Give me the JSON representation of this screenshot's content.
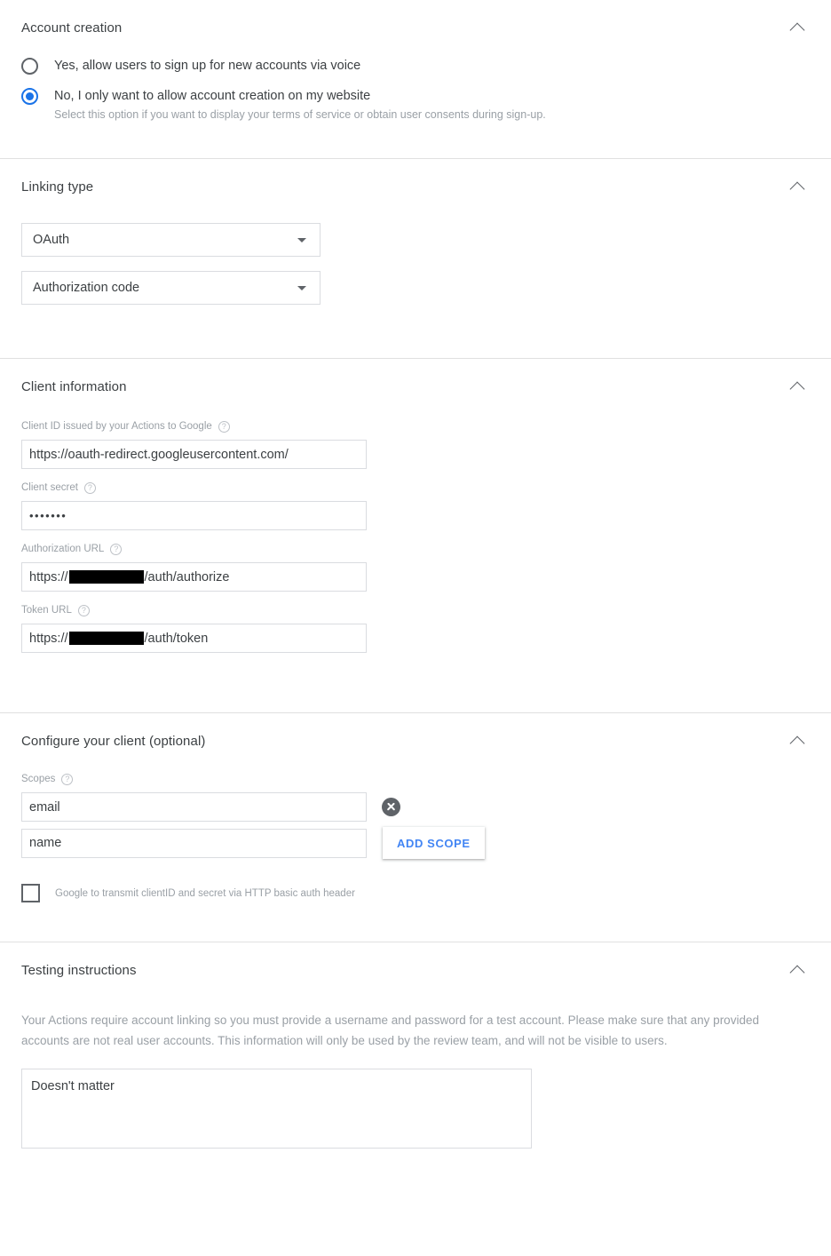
{
  "sections": [
    {
      "id": "account-creation",
      "title": "Account creation",
      "collapse_icon": "chevron-up-icon",
      "options": [
        {
          "label": "Yes, allow users to sign up for new accounts via voice",
          "selected": false,
          "sublabel": ""
        },
        {
          "label": "No, I only want to allow account creation on my website",
          "selected": true,
          "sublabel": "Select this option if you want to display your terms of service or obtain user consents during sign-up."
        }
      ]
    },
    {
      "id": "linking-type",
      "title": "Linking type",
      "collapse_icon": "chevron-up-icon",
      "selects": [
        {
          "name": "linking-type-select",
          "value": "OAuth"
        },
        {
          "name": "grant-type-select",
          "value": "Authorization code"
        }
      ]
    },
    {
      "id": "client-information",
      "title": "Client information",
      "collapse_icon": "chevron-up-icon",
      "fields": [
        {
          "name": "client-id-field",
          "label": "Client ID issued by your Actions to Google",
          "help": "help-icon",
          "value": "https://oauth-redirect.googleusercontent.com/",
          "type": "text"
        },
        {
          "name": "client-secret-field",
          "label": "Client secret",
          "help": "help-icon",
          "value": "•••••••",
          "type": "password"
        },
        {
          "name": "authorization-url-field",
          "label": "Authorization URL",
          "help": "help-icon",
          "prefix": "https://",
          "redacted": true,
          "suffix": "/auth/authorize",
          "type": "redacted"
        },
        {
          "name": "token-url-field",
          "label": "Token URL",
          "help": "help-icon",
          "prefix": "https://",
          "redacted": true,
          "suffix": "/auth/token",
          "type": "redacted"
        }
      ]
    },
    {
      "id": "configure-client",
      "title": "Configure your client (optional)",
      "collapse_icon": "chevron-up-icon",
      "scopes_label": "Scopes",
      "scopes_help": "help-icon",
      "scopes": [
        {
          "value": "email",
          "has_remove": true
        },
        {
          "value": "name",
          "has_remove": false
        }
      ],
      "add_scope_label": "ADD SCOPE",
      "checkbox": {
        "label": "Google to transmit clientID and secret via HTTP basic auth header",
        "checked": false
      }
    },
    {
      "id": "testing-instructions",
      "title": "Testing instructions",
      "collapse_icon": "chevron-up-icon",
      "description": "Your Actions require account linking so you must provide a username and password for a test account. Please make sure that any provided accounts are not real user accounts. This information will only be used by the review team, and will not be visible to users.",
      "textarea_value": "Doesn't matter"
    }
  ],
  "colors": {
    "accent": "#1a73e8",
    "link": "#4285f4",
    "text": "#3c4043",
    "muted": "#9aa0a6",
    "border": "#dadce0",
    "divider": "#e0e0e0",
    "redaction": "#000000"
  }
}
